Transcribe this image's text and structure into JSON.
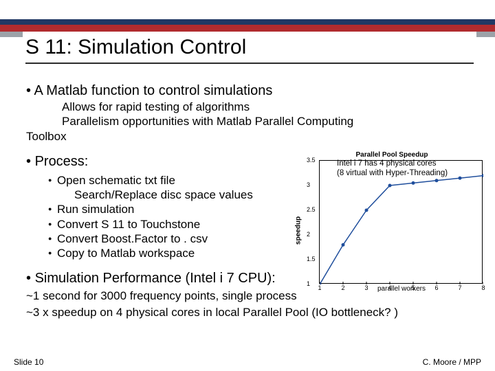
{
  "title": "S 11: Simulation Control",
  "bullets": {
    "b1": "A Matlab function to control simulations",
    "b1_sub1": "Allows for rapid testing of algorithms",
    "b1_sub2": "Parallelism opportunities with Matlab Parallel Computing",
    "b1_sub2_cont": "Toolbox",
    "b2": "Process:",
    "process": [
      {
        "line": "Open schematic txt file",
        "sub": "Search/Replace disc space values"
      },
      {
        "line": "Run simulation"
      },
      {
        "line": "Convert S 11 to Touchstone"
      },
      {
        "line": "Convert Boost.Factor to . csv"
      },
      {
        "line": "Copy to Matlab workspace"
      }
    ],
    "b3": "Simulation Performance (Intel i 7 CPU):",
    "perf1": "~1 second for 3000 frequency points, single process",
    "perf2": "~3 x speedup on 4 physical cores in local Parallel Pool (IO bottleneck? )"
  },
  "chart_note_l1": "Intel i 7 has 4 physical cores",
  "chart_note_l2": "(8 virtual with Hyper-Threading)",
  "chart_data": {
    "type": "line",
    "title": "Parallel Pool Speedup",
    "xlabel": "parallel workers",
    "ylabel": "speedup",
    "x": [
      1,
      2,
      3,
      4,
      5,
      6,
      7,
      8
    ],
    "values": [
      1.0,
      1.8,
      2.5,
      3.0,
      3.05,
      3.1,
      3.15,
      3.2
    ],
    "xlim": [
      1,
      8
    ],
    "ylim": [
      1.0,
      3.5
    ],
    "xticks": [
      1,
      2,
      3,
      4,
      5,
      6,
      7,
      8
    ],
    "yticks": [
      1.0,
      1.5,
      2.0,
      2.5,
      3.0,
      3.5
    ]
  },
  "footer": {
    "left": "Slide 10",
    "right": "C. Moore / MPP"
  }
}
